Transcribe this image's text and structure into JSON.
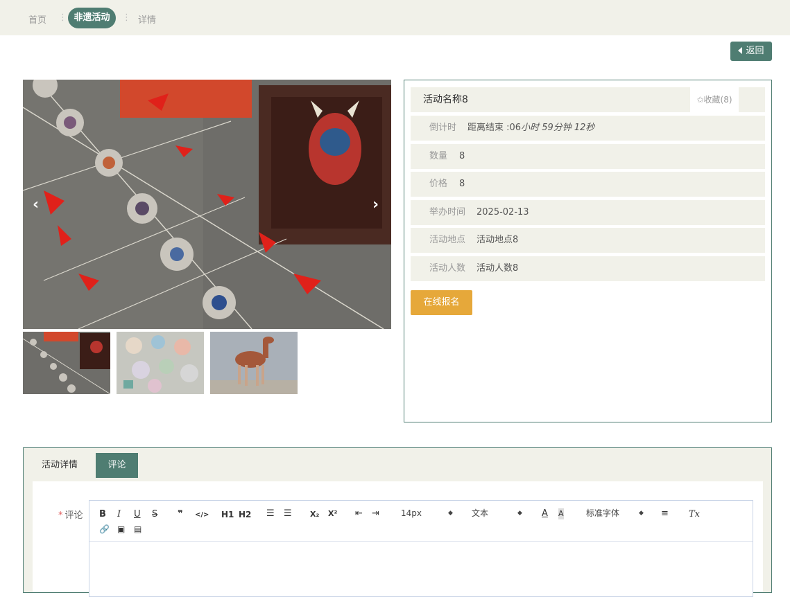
{
  "breadcrumb": {
    "home": "首页",
    "current": "非遗活动",
    "detail": "详情",
    "separator": "⋮"
  },
  "back_button": {
    "label": "返回"
  },
  "gallery": {
    "prev_icon": "chevron-left-icon",
    "next_icon": "chevron-right-icon",
    "thumbnails": [
      "peking-opera-mask-kites",
      "embroidered-pouches",
      "tang-horse-figurine"
    ]
  },
  "activity": {
    "name": "活动名称8",
    "favorite_label": "✩收藏(8)",
    "countdown_label": "倒计时",
    "countdown_prefix": "距离结束 :06",
    "countdown_rest": "小时 59分钟 12秒",
    "quantity_label": "数量",
    "quantity_value": "8",
    "price_label": "价格",
    "price_value": "8",
    "date_label": "举办时间",
    "date_value": "2025-02-13",
    "location_label": "活动地点",
    "location_value": "活动地点8",
    "people_label": "活动人数",
    "people_value": "活动人数8",
    "signup_label": "在线报名"
  },
  "tabs": {
    "detail": "活动详情",
    "comment": "评论"
  },
  "comment_form": {
    "required_mark": "*",
    "label": "评论",
    "toolbar": {
      "bold": "B",
      "italic": "I",
      "underline": "U",
      "strike": "S",
      "quote": "❞",
      "code": "</>",
      "h1": "H1",
      "h2": "H2",
      "x_sub": "X₂",
      "x_sup": "X²",
      "font_size": "14px",
      "text_type": "文本",
      "font_family": "标准字体",
      "clear_format": "Tx"
    }
  },
  "colors": {
    "accent": "#4f7d72",
    "signup": "#e6a83a",
    "panel_bg": "#f1f1e9"
  }
}
